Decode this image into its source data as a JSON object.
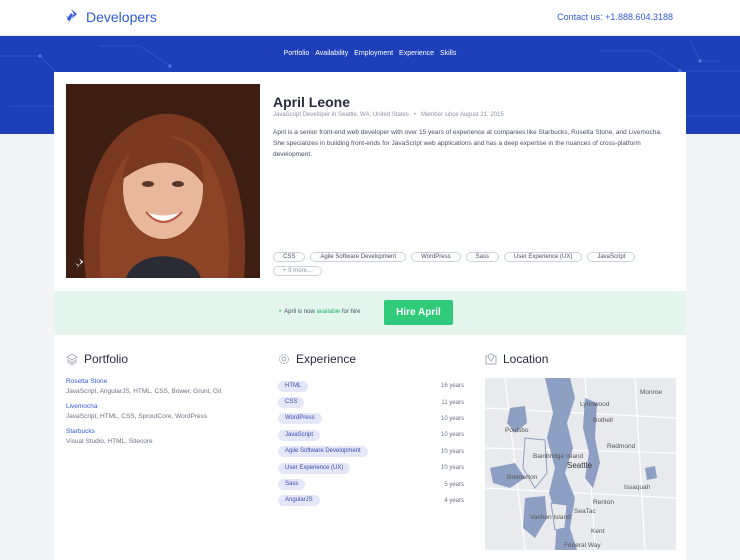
{
  "header": {
    "logo_text": "Developers",
    "contact": "Contact us: +1.888.604.3188"
  },
  "subnav": [
    "Portfolio",
    "Availability",
    "Employment",
    "Experience",
    "Skills"
  ],
  "profile": {
    "name": "April Leone",
    "role_location": "JavaScript Developer in Seattle, WA, United States",
    "member_since": "Member since August 21, 2015",
    "bio": "April is a senior front-end web developer with over 15 years of experience at companies like Starbucks, Rosetta Stone, and Livemocha. She specializes in building front-ends for JavaScript web applications and has a deep expertise in the nuances of cross-platform development.",
    "tags": [
      "CSS",
      "Agile Software Development",
      "WordPress",
      "Sass",
      "User Experience (UX)",
      "JavaScript"
    ],
    "more_tag": "+ 9 more..."
  },
  "hire": {
    "prefix": "April is now",
    "available": "available",
    "suffix": "for hire",
    "button": "Hire April"
  },
  "portfolio": {
    "title": "Portfolio",
    "items": [
      {
        "name": "Rosetta Stone",
        "tech": "JavaScript, AngularJS, HTML, CSS, Bower, Grunt, Git"
      },
      {
        "name": "Livemocha",
        "tech": "JavaScript, HTML, CSS, SproutCore, WordPress"
      },
      {
        "name": "Starbucks",
        "tech": "Visual Studio, HTML, Sitecore"
      }
    ]
  },
  "experience": {
    "title": "Experience",
    "items": [
      {
        "skill": "HTML",
        "years": "16 years"
      },
      {
        "skill": "CSS",
        "years": "11 years"
      },
      {
        "skill": "WordPress",
        "years": "10 years"
      },
      {
        "skill": "JavaScript",
        "years": "10 years"
      },
      {
        "skill": "Agile Software Development",
        "years": "10 years"
      },
      {
        "skill": "User Experience (UX)",
        "years": "10 years"
      },
      {
        "skill": "Sass",
        "years": "5 years"
      },
      {
        "skill": "AngularJS",
        "years": "4 years"
      }
    ]
  },
  "location": {
    "title": "Location",
    "map_labels": [
      "Monroe",
      "Lynnwood",
      "Poulsbo",
      "Bothell",
      "Redmond",
      "Bainbridge Island",
      "Seattle",
      "Bremerton",
      "Issaquah",
      "Renton",
      "SeaTac",
      "Kent",
      "Vashon Island",
      "Federal Way"
    ]
  },
  "colors": {
    "brand_blue": "#2e5bdc",
    "hero_blue": "#1d3fb8",
    "hire_green": "#2fcb7a",
    "hire_bar": "#e3f5ec"
  }
}
